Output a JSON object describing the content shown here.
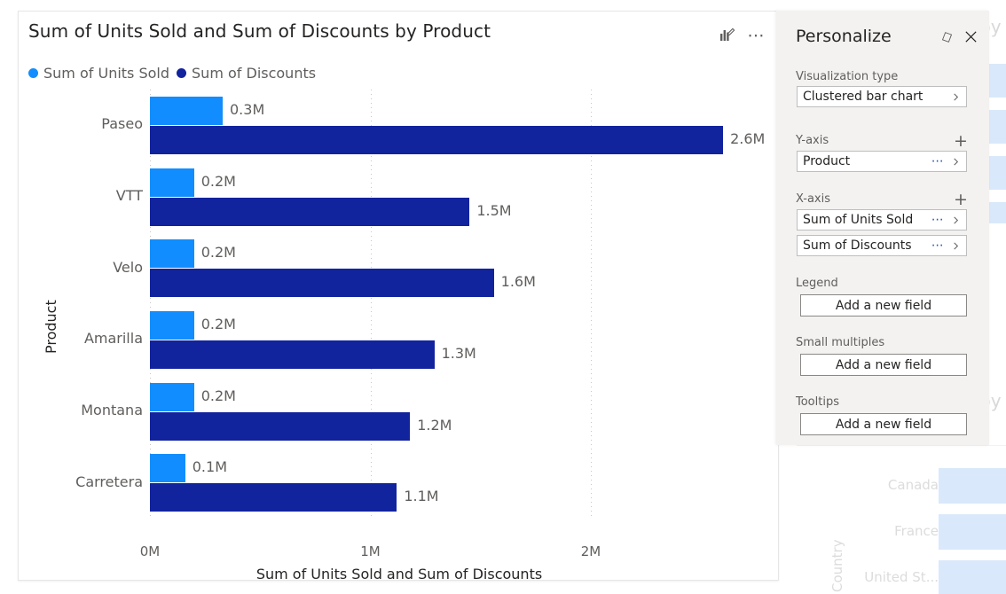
{
  "chart_card": {
    "title": "Sum of Units Sold and Sum of Discounts by Product",
    "personalize_icon": "personalize-visual-icon",
    "more_options_icon": "more-options-ellipsis",
    "legend": [
      {
        "label": "Sum of Units Sold",
        "color": "#118DFF"
      },
      {
        "label": "Sum of Discounts",
        "color": "#12239E"
      }
    ]
  },
  "chart_data": {
    "type": "bar",
    "title": "Sum of Units Sold and Sum of Discounts by Product",
    "orientation": "horizontal",
    "grouping": "clustered",
    "xlabel": "Sum of Units Sold and Sum of Discounts",
    "ylabel": "Product",
    "categories": [
      "Paseo",
      "VTT",
      "Velo",
      "Amarilla",
      "Montana",
      "Carretera"
    ],
    "xlim": [
      0,
      2.6
    ],
    "xticks": [
      0,
      1,
      2
    ],
    "xtick_labels": [
      "0M",
      "1M",
      "2M"
    ],
    "grid": "vertical-dotted",
    "legend_position": "top-left",
    "series": [
      {
        "name": "Sum of Units Sold",
        "color": "#118DFF",
        "values": [
          0.33,
          0.2,
          0.2,
          0.2,
          0.2,
          0.16
        ],
        "labels": [
          "0.3M",
          "0.2M",
          "0.2M",
          "0.2M",
          "0.2M",
          "0.1M"
        ]
      },
      {
        "name": "Sum of Discounts",
        "color": "#12239E",
        "values": [
          2.6,
          1.45,
          1.56,
          1.29,
          1.18,
          1.12
        ],
        "labels": [
          "2.6M",
          "1.5M",
          "1.6M",
          "1.3M",
          "1.2M",
          "1.1M"
        ]
      }
    ]
  },
  "personalize": {
    "title": "Personalize",
    "reset_icon": "eraser-reset-icon",
    "close_icon": "close-x-icon",
    "sections": [
      {
        "label": "Visualization type",
        "has_add": false
      },
      {
        "label": "Y-axis",
        "has_add": true
      },
      {
        "label": "X-axis",
        "has_add": true
      },
      {
        "label": "Legend",
        "has_add": false
      },
      {
        "label": "Small multiples",
        "has_add": false
      },
      {
        "label": "Tooltips",
        "has_add": false
      }
    ],
    "visualization_type": "Clustered bar chart",
    "y_axis_fields": [
      "Product"
    ],
    "x_axis_fields": [
      "Sum of Units Sold",
      "Sum of Discounts"
    ],
    "legend_placeholder": "Add a new field",
    "small_multiples_placeholder": "Add a new field",
    "tooltips_placeholder": "Add a new field"
  },
  "background": {
    "visual_top": {
      "title_fragment": "by"
    },
    "visual_bottom": {
      "title_fragment": "by",
      "axis_title": "Country",
      "categories": [
        "Canada",
        "France",
        "United St..."
      ]
    }
  }
}
